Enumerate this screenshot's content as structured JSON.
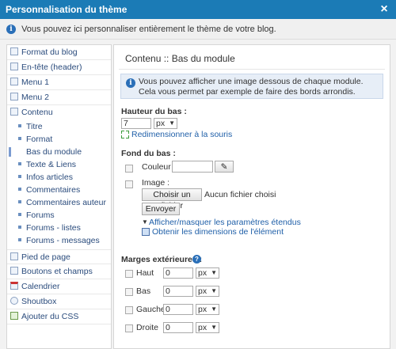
{
  "window": {
    "title": "Personnalisation du thème",
    "close_glyph": "×"
  },
  "info": {
    "text": "Vous pouvez ici personnaliser entièrement le thème de votre blog."
  },
  "sidebar": {
    "items_top": [
      {
        "label": "Format du blog",
        "icon": "layout-icon"
      },
      {
        "label": "En-tête (header)",
        "icon": "header-icon"
      },
      {
        "label": "Menu 1",
        "icon": "menu-icon"
      },
      {
        "label": "Menu 2",
        "icon": "menu-icon"
      },
      {
        "label": "Contenu",
        "icon": "content-icon"
      }
    ],
    "subitems": [
      {
        "label": "Titre"
      },
      {
        "label": "Format"
      },
      {
        "label": "Bas du module",
        "active": true
      },
      {
        "label": "Texte & Liens"
      },
      {
        "label": "Infos articles"
      },
      {
        "label": "Commentaires"
      },
      {
        "label": "Commentaires auteur"
      },
      {
        "label": "Forums"
      },
      {
        "label": "Forums - listes"
      },
      {
        "label": "Forums - messages"
      }
    ],
    "items_bottom": [
      {
        "label": "Pied de page",
        "icon": "footer-icon"
      },
      {
        "label": "Boutons et champs",
        "icon": "buttons-icon"
      },
      {
        "label": "Calendrier",
        "icon": "calendar-icon"
      },
      {
        "label": "Shoutbox",
        "icon": "chat-icon"
      },
      {
        "label": "Ajouter du CSS",
        "icon": "css-icon"
      }
    ]
  },
  "main": {
    "title": "Contenu :: Bas du module",
    "info": "Vous pouvez afficher une image dessous de chaque module. Cela vous permet par exemple de faire des bords arrondis.",
    "hauteur": {
      "label": "Hauteur du bas :",
      "value": "7",
      "unit": "px",
      "resize_link": "Redimensionner à la souris"
    },
    "fond": {
      "label": "Fond du bas :",
      "couleur_label": "Couleur :",
      "couleur_value": "",
      "image_label": "Image :",
      "choose_file": "Choisir un fichier",
      "no_file": "Aucun fichier choisi",
      "send": "Envoyer",
      "toggle_link": "Afficher/masquer les paramètres étendus",
      "dims_link": "Obtenir les dimensions de l'élément"
    },
    "marges": {
      "label": "Marges extérieures :",
      "help_glyph": "?",
      "rows": [
        {
          "label": "Haut",
          "value": "0",
          "unit": "px"
        },
        {
          "label": "Bas",
          "value": "0",
          "unit": "px"
        },
        {
          "label": "Gauche",
          "value": "0",
          "unit": "px"
        },
        {
          "label": "Droite",
          "value": "0",
          "unit": "px"
        }
      ]
    }
  },
  "colors": {
    "titlebar": "#1b7bb6",
    "link": "#1f5fa8",
    "accent": "#7a9bd0"
  }
}
